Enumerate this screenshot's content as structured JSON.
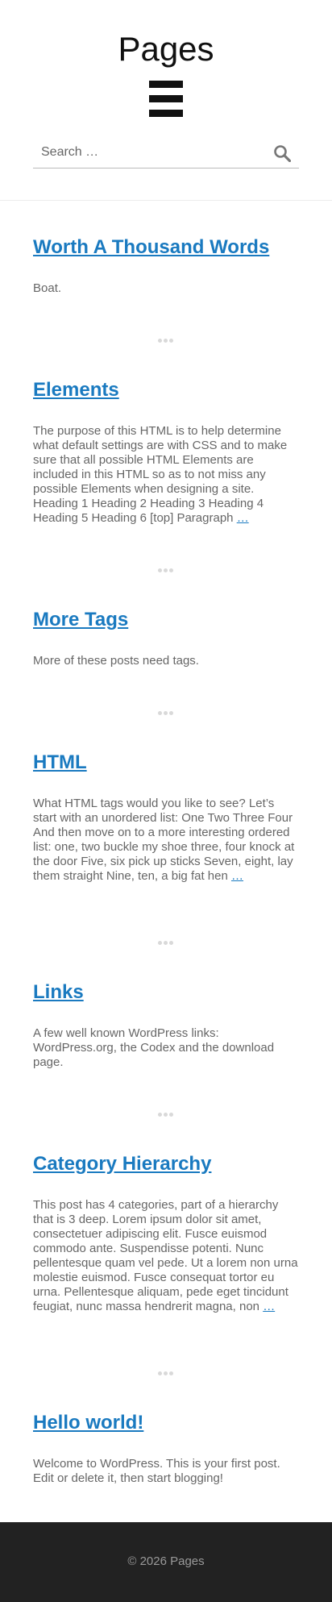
{
  "site": {
    "title": "Pages"
  },
  "search": {
    "placeholder": "Search …"
  },
  "posts": [
    {
      "title": "Worth A Thousand Words",
      "excerpt": "Boat.",
      "more": ""
    },
    {
      "title": "Elements",
      "excerpt": "The purpose of this HTML is to help determine what default settings are with CSS and to make sure that all possible HTML Elements are included in this HTML so as to not miss any possible Elements when designing a site. Heading 1 Heading 2 Heading 3 Heading 4 Heading 5 Heading 6 [top] Paragraph ",
      "more": "…"
    },
    {
      "title": "More Tags",
      "excerpt": "More of these posts need tags.",
      "more": ""
    },
    {
      "title": "HTML",
      "excerpt": "What HTML tags would you like to see? Let’s start with an unordered list: One Two Three Four And then move on to a more interesting ordered list: one, two buckle my shoe three, four knock at the door Five, six pick up sticks Seven, eight, lay them straight Nine, ten, a big fat hen ",
      "more": "…"
    },
    {
      "title": "Links",
      "excerpt": "A few well known WordPress links: WordPress.org, the Codex and the download page.",
      "more": ""
    },
    {
      "title": "Category Hierarchy",
      "excerpt": "This post has 4 categories, part of a hierarchy that is 3 deep. Lorem ipsum dolor sit amet, consectetuer adipiscing elit. Fusce euismod commodo ante. Suspendisse potenti. Nunc pellentesque quam vel pede. Ut a lorem non urna molestie euismod. Fusce consequat tortor eu urna. Pellentesque aliquam, pede eget tincidunt feugiat, nunc massa hendrerit magna, non ",
      "more": "…"
    },
    {
      "title": "Hello world!",
      "excerpt": "Welcome to WordPress. This is your first post. Edit or delete it, then start blogging!",
      "more": ""
    }
  ],
  "footer": {
    "text": "© 2026 Pages"
  },
  "colors": {
    "link": "#1a7ac0",
    "footer_bg": "#222222",
    "text": "#666666"
  },
  "icons": {
    "menu": "hamburger-menu-icon",
    "search": "search-icon"
  }
}
